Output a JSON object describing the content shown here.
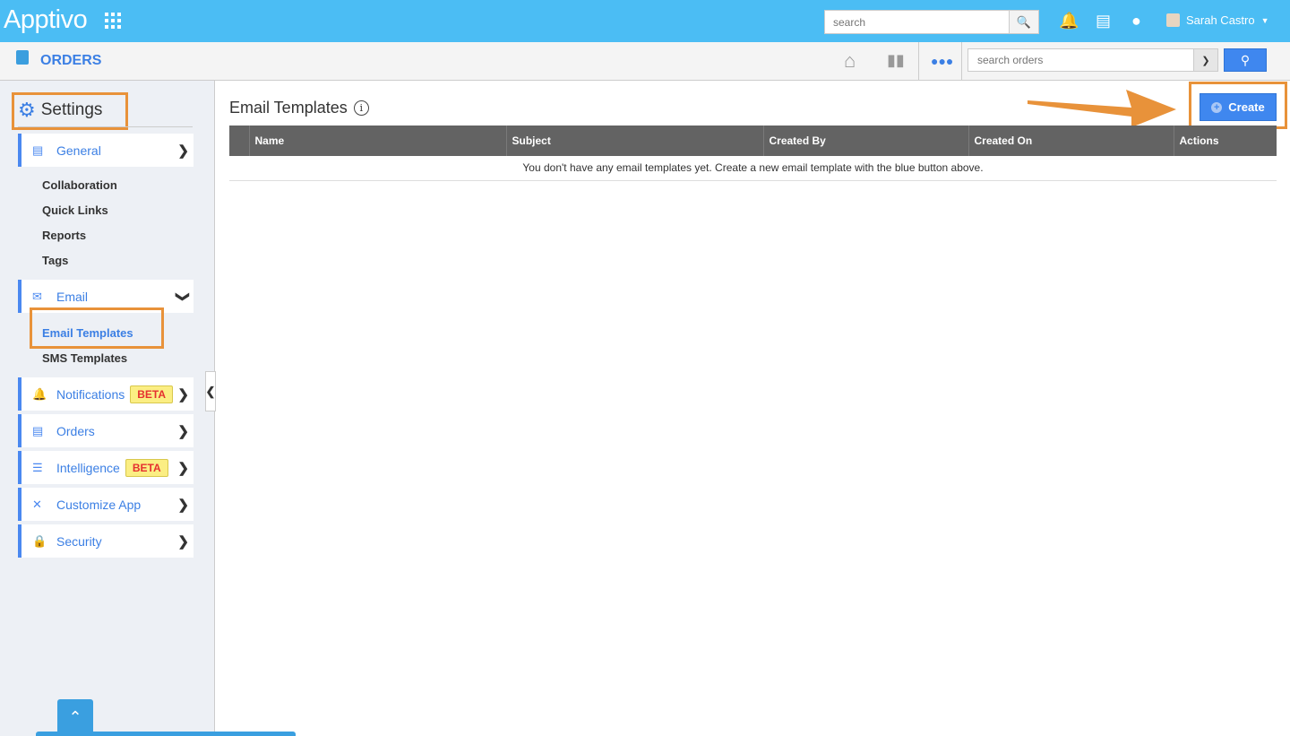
{
  "topbar": {
    "logo": "Apptivo",
    "search_placeholder": "search",
    "user_name": "Sarah Castro"
  },
  "subbar": {
    "app_title": "ORDERS",
    "search_placeholder": "search orders"
  },
  "sidebar": {
    "title": "Settings",
    "general": "General",
    "general_items": [
      "Collaboration",
      "Quick Links",
      "Reports",
      "Tags"
    ],
    "email": "Email",
    "email_items": [
      "Email Templates",
      "SMS Templates"
    ],
    "items": [
      {
        "label": "Notifications",
        "badge": "BETA"
      },
      {
        "label": "Orders"
      },
      {
        "label": "Intelligence",
        "badge": "BETA"
      },
      {
        "label": "Customize App"
      },
      {
        "label": "Security"
      }
    ]
  },
  "main": {
    "title": "Email Templates",
    "create_label": "Create",
    "columns": [
      "",
      "Name",
      "Subject",
      "Created By",
      "Created On",
      "Actions"
    ],
    "empty_message": "You don't have any email templates yet. Create a new email template with the blue button above."
  },
  "colors": {
    "topbar": "#4bbdf4",
    "accent": "#3b7fe4",
    "highlight": "#e8923a",
    "button": "#3f87ef"
  }
}
